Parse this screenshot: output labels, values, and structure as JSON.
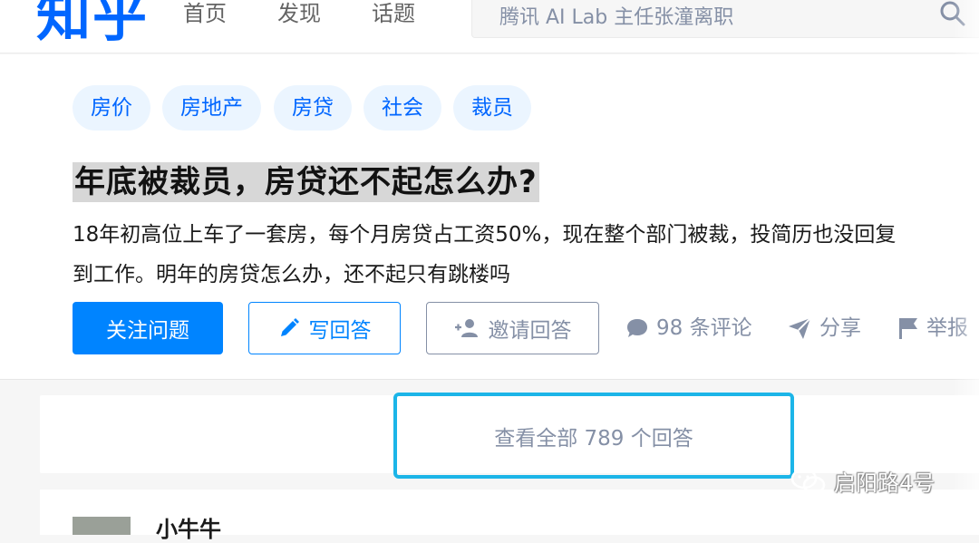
{
  "header": {
    "logo": "知乎",
    "nav": [
      "首页",
      "发现",
      "话题"
    ],
    "search_placeholder": "腾讯 AI Lab 主任张潼离职"
  },
  "question": {
    "tags": [
      "房价",
      "房地产",
      "房贷",
      "社会",
      "裁员"
    ],
    "title": "年底被裁员，房贷还不起怎么办?",
    "description_lines": [
      "18年初高位上车了一套房，每个月房贷占工资50%，现在整个部门被裁，投简历也没回复",
      "到工作。明年的房贷怎么办，还不起只有跳楼吗"
    ],
    "follow_label": "关注问题",
    "write_label": "写回答",
    "invite_label": "邀请回答",
    "comments_label": "98 条评论",
    "share_label": "分享",
    "report_label": "举报"
  },
  "answers": {
    "view_all_label": "查看全部 789 个回答",
    "first_author": "小牛牛"
  },
  "watermark": "启阳路4号",
  "colors": {
    "brand": "#0066ff",
    "primary_button": "#0084ff",
    "highlight_border": "#1cb5e8"
  }
}
